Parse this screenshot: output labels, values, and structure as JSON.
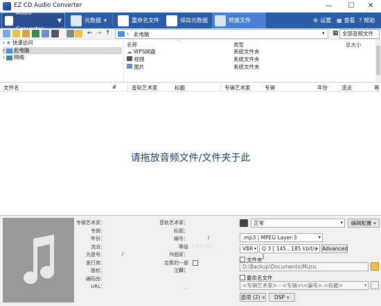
{
  "window": {
    "title": "EZ CD Audio Converter",
    "controls": {
      "minimize": "—",
      "maximize": "☐",
      "close": "✕"
    }
  },
  "ribbon": {
    "app_menu": "Audio Converter",
    "buttons": [
      "元数据",
      "重命名文件",
      "保存元数据",
      "转换文件"
    ],
    "right": [
      "设置",
      "查看",
      "帮助"
    ]
  },
  "toolbar": {
    "path_label": "此电脑",
    "nav": {
      "back": "←",
      "forward": "→",
      "up": "↑"
    },
    "filter": "全部音频文件"
  },
  "tree": {
    "items": [
      "快速访问",
      "此电脑",
      "网络"
    ]
  },
  "filelist": {
    "headers": [
      "名称",
      "类型",
      "总大小"
    ],
    "rows": [
      {
        "name": "WPS网盘",
        "type": "系统文件夹"
      },
      {
        "name": "视频",
        "type": "系统文件夹"
      },
      {
        "name": "图片",
        "type": "系统文件夹"
      }
    ]
  },
  "tracks": {
    "headers": [
      "文件名",
      "#",
      "音轨艺术家",
      "标题",
      "专辑艺术家",
      "专辑",
      "年份",
      "流派",
      "等级"
    ]
  },
  "drop_message": "请拖放音频文件/文件夹于此",
  "metadata": {
    "left_labels": [
      "专辑艺术家：",
      "专辑：",
      "年份：",
      "流派：",
      "光盘号：",
      "发行商：",
      "版权：",
      "编码由：",
      "URL："
    ],
    "right_labels": [
      "音轨艺术家：",
      "标题：",
      "编号：",
      "等级",
      "作曲家：",
      "合集的一部分：",
      "注释："
    ],
    "disc_sep": "/",
    "track_sep": "/",
    "url_dots": "..."
  },
  "output": {
    "profile": "正常",
    "edit_profile": "编辑配置 »",
    "format": ".mp3 | MPEG Layer-3",
    "mode": "VBR",
    "quality": "Q 3 [ 145...185 kbit/s ]",
    "advanced": "Advanced",
    "folder_label": "文件夹",
    "folder_path": "D:\\Backup\\Documents\\Music",
    "rename_label": "重命名文件",
    "rename_pattern": "<专辑艺术家> - <专辑>\\<编号>.<标题>",
    "options_btn": "选项 (2) »",
    "dsp_btn": "DSP »"
  }
}
